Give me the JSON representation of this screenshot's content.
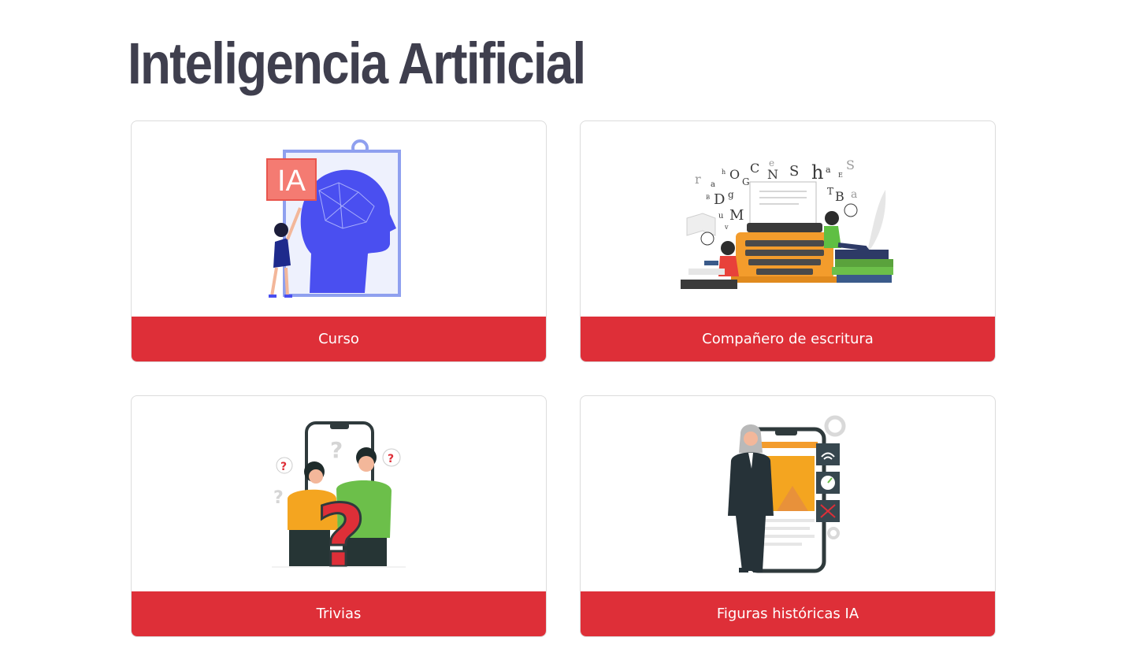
{
  "header": {
    "title": "Inteligencia Artificial"
  },
  "cards": [
    {
      "label": "Curso",
      "illustration": "ai-head-illustration",
      "accent": "#de2f38"
    },
    {
      "label": "Compañero de escritura",
      "illustration": "typewriter-illustration",
      "accent": "#de2f38"
    },
    {
      "label": "Trivias",
      "illustration": "question-people-illustration",
      "accent": "#de2f38"
    },
    {
      "label": "Figuras históricas IA",
      "illustration": "historic-figure-phone-illustration",
      "accent": "#de2f38"
    }
  ],
  "illustrations": {
    "ai_badge": "IA",
    "letters": [
      "r",
      "a",
      "h",
      "O",
      "G",
      "C",
      "e",
      "N",
      "S",
      "h",
      "a",
      "E",
      "S",
      "D",
      "g",
      "M",
      "T",
      "B",
      "a",
      "u",
      "v",
      "B"
    ]
  }
}
